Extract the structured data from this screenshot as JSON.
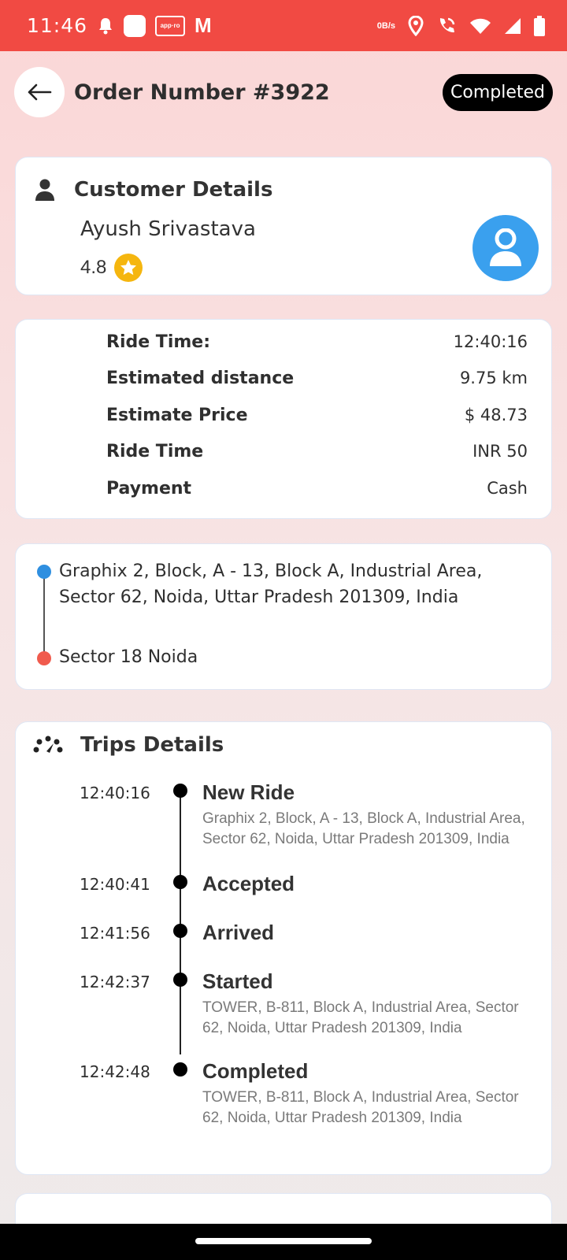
{
  "status_bar": {
    "time": "11:46",
    "store_text": "app·ro",
    "gmail_glyph": "M",
    "kbs_top": "0",
    "kbs_bottom": "B/s",
    "color": "#f14a43"
  },
  "header": {
    "title": "Order Number #3922",
    "status": "Completed"
  },
  "customer": {
    "title": "Customer Details",
    "name": "Ayush Srivastava",
    "rating": "4.8"
  },
  "ride": {
    "rows": [
      {
        "label": "Ride Time:",
        "value": "12:40:16"
      },
      {
        "label": "Estimated distance",
        "value": "9.75 km"
      },
      {
        "label": "Estimate Price",
        "value": "$ 48.73"
      },
      {
        "label": "Ride Time",
        "value": "INR 50"
      },
      {
        "label": "Payment",
        "value": "Cash"
      }
    ]
  },
  "route": {
    "pickup": "Graphix 2, Block, A - 13, Block A, Industrial Area, Sector 62, Noida, Uttar Pradesh 201309, India",
    "drop": "Sector 18 Noida"
  },
  "trips": {
    "title": "Trips Details",
    "events": [
      {
        "time": "12:40:16",
        "title": "New Ride",
        "address": "Graphix 2, Block, A - 13, Block A, Industrial Area, Sector 62, Noida, Uttar Pradesh 201309, India"
      },
      {
        "time": "12:40:41",
        "title": "Accepted",
        "address": ""
      },
      {
        "time": "12:41:56",
        "title": "Arrived",
        "address": ""
      },
      {
        "time": "12:42:37",
        "title": "Started",
        "address": "TOWER, B-811, Block A, Industrial Area, Sector 62, Noida, Uttar Pradesh 201309, India"
      },
      {
        "time": "12:42:48",
        "title": "Completed",
        "address": "TOWER, B-811, Block A, Industrial Area, Sector 62, Noida, Uttar Pradesh 201309, India"
      }
    ]
  },
  "icons": {
    "back": "arrow-left-icon",
    "customer": "person-icon",
    "avatar": "user-avatar-icon",
    "rating": "star-icon",
    "trips": "speedometer-icon"
  },
  "colors": {
    "accent_blue": "#2f8fe0",
    "drop_red": "#f05b4d",
    "rating_gold": "#f5b60f",
    "avatar_blue": "#3aa0ee"
  }
}
